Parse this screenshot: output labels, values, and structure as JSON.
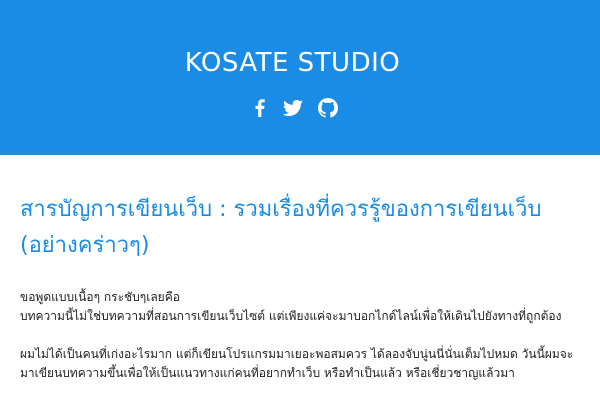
{
  "header": {
    "site_title": "KOSATE STUDIO",
    "background_color": "#1a8ce6",
    "social_links": [
      {
        "icon": "facebook-icon"
      },
      {
        "icon": "twitter-icon"
      },
      {
        "icon": "github-icon"
      }
    ]
  },
  "article": {
    "title": "สารบัญการเขียนเว็บ : รวมเรื่องที่ควรรู้ของการเขียนเว็บ (อย่างคร่าวๆ)",
    "title_color": "#1a8ce6",
    "paragraphs": [
      "ขอพูดแบบเนื้อๆ กระชับๆเลยคือ\nบทความนี้ไม่ใช่บทความที่สอนการเขียนเว็บไซต์ แต่เพียงแค่จะมาบอกไกด์ไลน์เพื่อให้เดินไปยังทางที่ถูกต้อง",
      "ผมไม่ได้เป็นคนที่เก่งอะไรมาก แต่ก็เขียนโปรแกรมมาเยอะพอสมควร ได้ลองจับนู่นนี่นั่นเต็มไปหมด วันนี้ผมจะมาเขียนบทความขึ้นเพื่อให้เป็นแนวทางแก่คนที่อยากทำเว็บ หรือทำเป็นแล้ว หรือเชี่ยวชาญแล้วมา"
    ]
  }
}
